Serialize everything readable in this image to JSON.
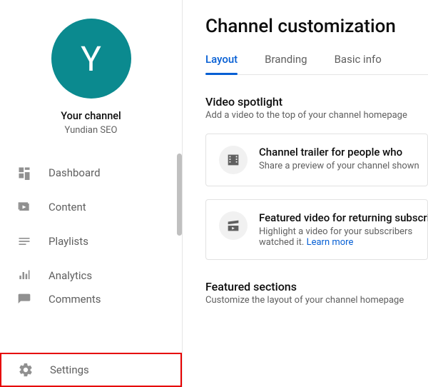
{
  "sidebar": {
    "avatar_letter": "Y",
    "title": "Your channel",
    "subtitle": "Yundian SEO",
    "items": [
      {
        "icon": "dashboard",
        "label": "Dashboard"
      },
      {
        "icon": "content",
        "label": "Content"
      },
      {
        "icon": "playlists",
        "label": "Playlists"
      },
      {
        "icon": "analytics",
        "label": "Analytics"
      },
      {
        "icon": "comments",
        "label": "Comments"
      }
    ],
    "settings_label": "Settings"
  },
  "main": {
    "page_title": "Channel customization",
    "tabs": [
      {
        "label": "Layout",
        "active": true
      },
      {
        "label": "Branding",
        "active": false
      },
      {
        "label": "Basic info",
        "active": false
      }
    ],
    "spotlight": {
      "title": "Video spotlight",
      "desc": "Add a video to the top of your channel homepage",
      "cards": [
        {
          "icon": "film",
          "title": "Channel trailer for people who ",
          "sub": "Share a preview of your channel shown"
        },
        {
          "icon": "clip",
          "title": "Featured video for returning subscribers",
          "sub_pre": "Highlight a video for your subscribers",
          "sub_post": "watched it.  ",
          "learn": "Learn more"
        }
      ]
    },
    "featured": {
      "title": "Featured sections",
      "desc": "Customize the layout of your channel homepage"
    }
  }
}
